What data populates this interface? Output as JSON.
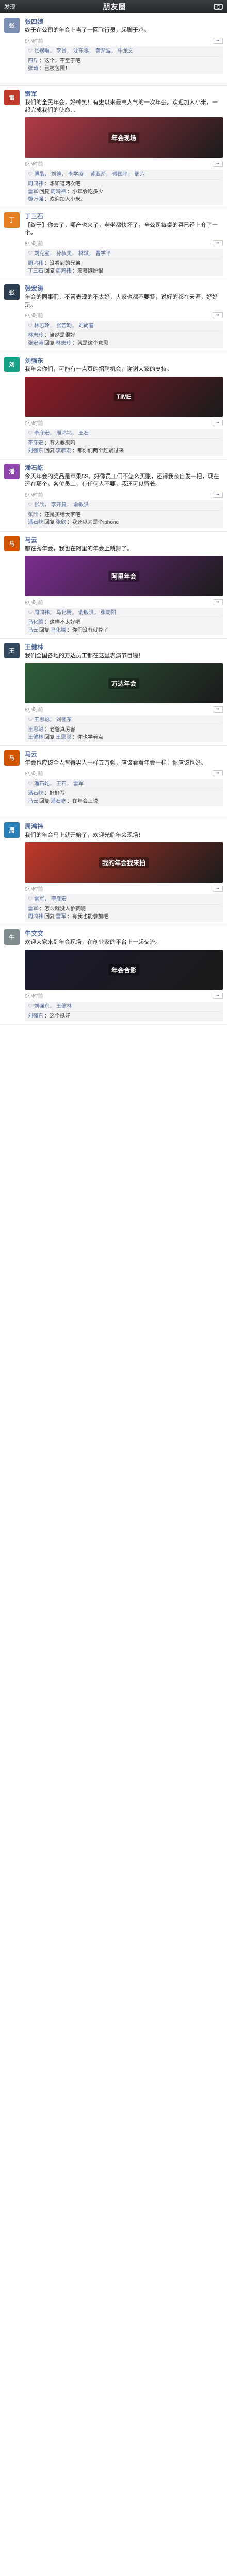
{
  "header": {
    "back": "发现",
    "title": "朋友圈"
  },
  "posts": [
    {
      "author": "张四娘",
      "avatar_color": "#7a8fb3",
      "text": "终于在公司的年会上当了一回飞行员，起脚于鸡。",
      "image": "",
      "time": "8小时前",
      "likes": [
        "张拐啦",
        "李景",
        "沈东零",
        "黄渐波",
        "牛龙文"
      ],
      "comments": [
        {
          "name": "四斤",
          "text": "这个，不至于吧"
        },
        {
          "name": "张琦",
          "text": "已被包围！"
        }
      ]
    },
    {
      "author": "雷军",
      "avatar_color": "#c0392b",
      "text": "我们的全民年会，好棒笑！有史以来最高人气的一次年会。欢迎加入小米，一起完成我们的使命…",
      "image": "年会现场",
      "image_color": "#b23a48",
      "time": "8小时前",
      "likes": [
        "博晶",
        "刘德",
        "李学凌",
        "黄亚渐",
        "傅国平",
        "周六"
      ],
      "comments": [
        {
          "name": "周鸿祎",
          "text": "想知道两次吧"
        },
        {
          "name": "雷军",
          "reply_to": "周鸿祎",
          "text": "小年会吃多少"
        },
        {
          "name": "黎万强",
          "text": "欢迎加入小米。"
        }
      ]
    },
    {
      "author": "丁三石",
      "avatar_color": "#e67e22",
      "text": "【终于】你去了，哪产也来了，老坐都快坏了，全公司每桌的菜已经上齐了一个。",
      "image": "",
      "time": "8小时前",
      "likes": [
        "刘克宝",
        "孙叔夫",
        "林斌",
        "曹学平"
      ],
      "comments": [
        {
          "name": "周鸿祎",
          "text": "没看到的兄弟"
        },
        {
          "name": "丁三石",
          "reply_to": "周鸿祎",
          "text": "羡慕嫉妒恨"
        }
      ]
    },
    {
      "author": "张宏涛",
      "avatar_color": "#2c3e50",
      "text": "年会的同事们，不管表现的不太好，大家也都不要紧，说好的都在天涯，好好玩。",
      "image": "",
      "time": "8小时前",
      "likes": [
        "林志玲",
        "张若昀",
        "刘尚春"
      ],
      "comments": [
        {
          "name": "林志玲",
          "text": "当然是很好"
        },
        {
          "name": "张宏涛",
          "reply_to": "林志玲",
          "text": "就是这个意思"
        }
      ]
    },
    {
      "author": "刘强东",
      "avatar_color": "#16a085",
      "text": "我年会你们，可能有一点页的招聘机会，谢谢大家的支持。",
      "image": "TIME",
      "image_color": "#8e1c2a",
      "time": "8小时前",
      "likes": [
        "李彦宏",
        "周鸿祎",
        "王石"
      ],
      "comments": [
        {
          "name": "李彦宏",
          "text": "有人要来吗"
        },
        {
          "name": "刘强东",
          "reply_to": "李彦宏",
          "text": "那你们两个赶紧过来"
        }
      ]
    },
    {
      "author": "潘石屹",
      "avatar_color": "#8e44ad",
      "text": "今天年会的奖品是苹果5S，好像员工们不怎么买账，还得我亲自发一把，现在还在那个，各位员工，有任何人不要，我还可以留着。",
      "image": "",
      "time": "8小时前",
      "likes": [
        "张欣",
        "李开复",
        "俞敏洪"
      ],
      "comments": [
        {
          "name": "张欣",
          "text": "还是买给大家吧"
        },
        {
          "name": "潘石屹",
          "reply_to": "张欣",
          "text": "我还以为是个iphone"
        }
      ]
    },
    {
      "author": "马云",
      "avatar_color": "#d35400",
      "text": "都在秀年会，我也在阿里的年会上跳舞了。",
      "image": "阿里年会",
      "image_color": "#7b2d8e",
      "time": "8小时前",
      "likes": [
        "周鸿祎",
        "马化腾",
        "俞敏洪",
        "张朝阳"
      ],
      "comments": [
        {
          "name": "马化腾",
          "text": "这样不太好吧"
        },
        {
          "name": "马云",
          "reply_to": "马化腾",
          "text": "你们没有就算了"
        }
      ]
    },
    {
      "author": "王健林",
      "avatar_color": "#34495e",
      "text": "我们全国各地的万达员工都在这里表演节目啦！",
      "image": "万达年会",
      "image_color": "#2e5e3a",
      "time": "8小时前",
      "likes": [
        "王思聪",
        "刘强东"
      ],
      "comments": [
        {
          "name": "王思聪",
          "text": "老爸真厉害"
        },
        {
          "name": "王健林",
          "reply_to": "王思聪",
          "text": "你也学着点"
        }
      ]
    },
    {
      "author": "马云",
      "avatar_color": "#d35400",
      "text": "年会也应该全人皆得男人一样五万强，应该看看年会一样，你应该也好。",
      "image": "",
      "time": "8小时前",
      "likes": [
        "潘石屹",
        "王石",
        "雷军"
      ],
      "comments": [
        {
          "name": "潘石屹",
          "text": "好好写"
        },
        {
          "name": "马云",
          "reply_to": "潘石屹",
          "text": "在年会上说"
        }
      ]
    },
    {
      "author": "周鸿祎",
      "avatar_color": "#2980b9",
      "text": "我们的年会马上就开始了，欢迎光临年会现场！",
      "image": "我的年会我来拍",
      "image_color": "#c0392b",
      "time": "8小时前",
      "likes": [
        "雷军",
        "李彦宏"
      ],
      "comments": [
        {
          "name": "雷军",
          "text": "怎么就没人参赛呢"
        },
        {
          "name": "周鸿祎",
          "reply_to": "雷军",
          "text": "有我也能参加吧"
        }
      ]
    },
    {
      "author": "牛文文",
      "avatar_color": "#7f8c8d",
      "text": "欢迎大家来到年会现场，在创业家的平台上一起交流。",
      "image": "年会合影",
      "image_color": "#1a1a2e",
      "time": "8小时前",
      "likes": [
        "刘强东",
        "王健林"
      ],
      "comments": [
        {
          "name": "刘强东",
          "text": "这个挺好"
        }
      ]
    }
  ]
}
